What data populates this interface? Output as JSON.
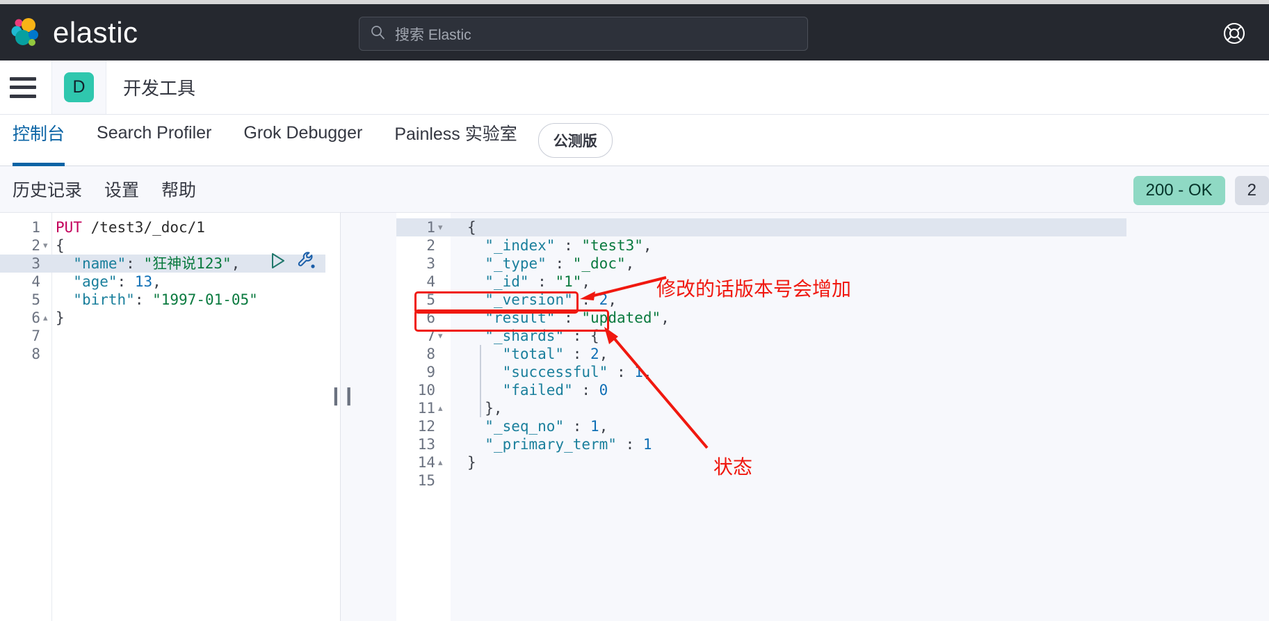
{
  "header": {
    "brand_name": "elastic",
    "logo_icon": "elastic-logo-icon",
    "search": {
      "icon": "search-icon",
      "placeholder": "搜索 Elastic",
      "value": ""
    },
    "help_icon": "lifebuoy-help-icon"
  },
  "app_nav": {
    "menu_icon": "hamburger-menu-icon",
    "app_badge": "D",
    "app_title": "开发工具"
  },
  "tabs": [
    {
      "label": "控制台",
      "active": true
    },
    {
      "label": "Search Profiler",
      "active": false
    },
    {
      "label": "Grok Debugger",
      "active": false
    },
    {
      "label": "Painless 实验室",
      "active": false
    }
  ],
  "beta_badge": "公测版",
  "console_toolbar": {
    "links": [
      "历史记录",
      "设置",
      "帮助"
    ],
    "status_code": "200 - OK",
    "status_time": "2"
  },
  "request_editor": {
    "run_icon": "play-triangle-icon",
    "wrench_icon": "wrench-icon",
    "active_line": 3,
    "lines": [
      {
        "n": "1",
        "fold": "",
        "tokens": [
          {
            "t": "PUT",
            "c": "k-method"
          },
          {
            "t": " /test3/_doc/1",
            "c": "k-url"
          }
        ]
      },
      {
        "n": "2",
        "fold": "▾",
        "tokens": [
          {
            "t": "{",
            "c": "k-punct"
          }
        ]
      },
      {
        "n": "3",
        "fold": "",
        "tokens": [
          {
            "t": "  ",
            "c": "k-punct"
          },
          {
            "t": "\"name\"",
            "c": "k-key"
          },
          {
            "t": ": ",
            "c": "k-punct"
          },
          {
            "t": "\"狂神说123\"",
            "c": "k-cn"
          },
          {
            "t": ",",
            "c": "k-punct"
          }
        ]
      },
      {
        "n": "4",
        "fold": "",
        "tokens": [
          {
            "t": "  ",
            "c": "k-punct"
          },
          {
            "t": "\"age\"",
            "c": "k-key"
          },
          {
            "t": ": ",
            "c": "k-punct"
          },
          {
            "t": "13",
            "c": "k-num"
          },
          {
            "t": ",",
            "c": "k-punct"
          }
        ]
      },
      {
        "n": "5",
        "fold": "",
        "tokens": [
          {
            "t": "  ",
            "c": "k-punct"
          },
          {
            "t": "\"birth\"",
            "c": "k-key"
          },
          {
            "t": ": ",
            "c": "k-punct"
          },
          {
            "t": "\"1997-01-05\"",
            "c": "k-str"
          }
        ]
      },
      {
        "n": "6",
        "fold": "▴",
        "tokens": [
          {
            "t": "}",
            "c": "k-punct"
          }
        ]
      },
      {
        "n": "7",
        "fold": "",
        "tokens": []
      },
      {
        "n": "8",
        "fold": "",
        "tokens": []
      }
    ]
  },
  "response_viewer": {
    "active_line": 1,
    "lines": [
      {
        "n": "1",
        "fold": "▾",
        "tokens": [
          {
            "t": "{",
            "c": "k-punct"
          }
        ]
      },
      {
        "n": "2",
        "fold": "",
        "tokens": [
          {
            "t": "  ",
            "c": "k-punct"
          },
          {
            "t": "\"_index\"",
            "c": "k-key"
          },
          {
            "t": " : ",
            "c": "k-punct"
          },
          {
            "t": "\"test3\"",
            "c": "k-str"
          },
          {
            "t": ",",
            "c": "k-punct"
          }
        ]
      },
      {
        "n": "3",
        "fold": "",
        "tokens": [
          {
            "t": "  ",
            "c": "k-punct"
          },
          {
            "t": "\"_type\"",
            "c": "k-key"
          },
          {
            "t": " : ",
            "c": "k-punct"
          },
          {
            "t": "\"_doc\"",
            "c": "k-str"
          },
          {
            "t": ",",
            "c": "k-punct"
          }
        ]
      },
      {
        "n": "4",
        "fold": "",
        "tokens": [
          {
            "t": "  ",
            "c": "k-punct"
          },
          {
            "t": "\"_id\"",
            "c": "k-key"
          },
          {
            "t": " : ",
            "c": "k-punct"
          },
          {
            "t": "\"1\"",
            "c": "k-str"
          },
          {
            "t": ",",
            "c": "k-punct"
          }
        ]
      },
      {
        "n": "5",
        "fold": "",
        "tokens": [
          {
            "t": "  ",
            "c": "k-punct"
          },
          {
            "t": "\"_version\"",
            "c": "k-key"
          },
          {
            "t": " : ",
            "c": "k-punct"
          },
          {
            "t": "2",
            "c": "k-num"
          },
          {
            "t": ",",
            "c": "k-punct"
          }
        ]
      },
      {
        "n": "6",
        "fold": "",
        "tokens": [
          {
            "t": "  ",
            "c": "k-punct"
          },
          {
            "t": "\"result\"",
            "c": "k-key"
          },
          {
            "t": " : ",
            "c": "k-punct"
          },
          {
            "t": "\"updated\"",
            "c": "k-str"
          },
          {
            "t": ",",
            "c": "k-punct"
          }
        ]
      },
      {
        "n": "7",
        "fold": "▾",
        "tokens": [
          {
            "t": "  ",
            "c": "k-punct"
          },
          {
            "t": "\"_shards\"",
            "c": "k-key"
          },
          {
            "t": " : ",
            "c": "k-punct"
          },
          {
            "t": "{",
            "c": "k-punct"
          }
        ]
      },
      {
        "n": "8",
        "fold": "",
        "tokens": [
          {
            "t": "    ",
            "c": "k-punct"
          },
          {
            "t": "\"total\"",
            "c": "k-key"
          },
          {
            "t": " : ",
            "c": "k-punct"
          },
          {
            "t": "2",
            "c": "k-num"
          },
          {
            "t": ",",
            "c": "k-punct"
          }
        ]
      },
      {
        "n": "9",
        "fold": "",
        "tokens": [
          {
            "t": "    ",
            "c": "k-punct"
          },
          {
            "t": "\"successful\"",
            "c": "k-key"
          },
          {
            "t": " : ",
            "c": "k-punct"
          },
          {
            "t": "1",
            "c": "k-num"
          },
          {
            "t": ",",
            "c": "k-punct"
          }
        ]
      },
      {
        "n": "10",
        "fold": "",
        "tokens": [
          {
            "t": "    ",
            "c": "k-punct"
          },
          {
            "t": "\"failed\"",
            "c": "k-key"
          },
          {
            "t": " : ",
            "c": "k-punct"
          },
          {
            "t": "0",
            "c": "k-num"
          }
        ]
      },
      {
        "n": "11",
        "fold": "▴",
        "tokens": [
          {
            "t": "  },",
            "c": "k-punct"
          }
        ]
      },
      {
        "n": "12",
        "fold": "",
        "tokens": [
          {
            "t": "  ",
            "c": "k-punct"
          },
          {
            "t": "\"_seq_no\"",
            "c": "k-key"
          },
          {
            "t": " : ",
            "c": "k-punct"
          },
          {
            "t": "1",
            "c": "k-num"
          },
          {
            "t": ",",
            "c": "k-punct"
          }
        ]
      },
      {
        "n": "13",
        "fold": "",
        "tokens": [
          {
            "t": "  ",
            "c": "k-punct"
          },
          {
            "t": "\"_primary_term\"",
            "c": "k-key"
          },
          {
            "t": " : ",
            "c": "k-punct"
          },
          {
            "t": "1",
            "c": "k-num"
          }
        ]
      },
      {
        "n": "14",
        "fold": "▴",
        "tokens": [
          {
            "t": "}",
            "c": "k-punct"
          }
        ]
      },
      {
        "n": "15",
        "fold": "",
        "tokens": []
      }
    ]
  },
  "annotations": {
    "color": "#f0180f",
    "version_note": "修改的话版本号会增加",
    "status_note": "状态"
  },
  "split_handle": "❙❙"
}
